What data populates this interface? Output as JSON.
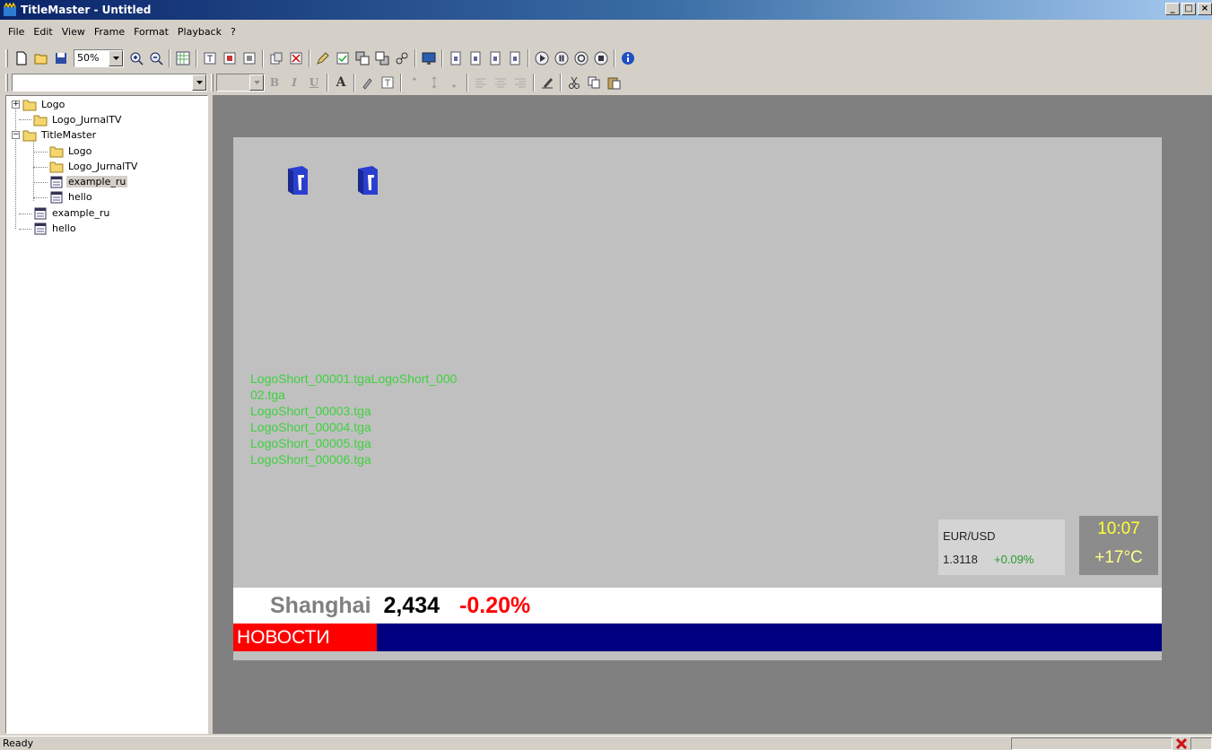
{
  "window": {
    "title": "TitleMaster - Untitled",
    "controls": [
      "_",
      "□",
      "×"
    ]
  },
  "menu": [
    "File",
    "Edit",
    "View",
    "Frame",
    "Format",
    "Playback",
    "?"
  ],
  "toolbar": {
    "zoom": "50%",
    "icons": [
      "new-icon",
      "open-icon",
      "save-icon",
      "zoom-in-icon",
      "zoom-out-icon",
      "grid-icon",
      "frame-icon",
      "play-icon",
      "pause-icon",
      "stop-icon",
      "info-icon"
    ]
  },
  "format_toolbar": {
    "font_value": "",
    "size_value": "",
    "bold": "B",
    "italic": "I",
    "underline": "U",
    "font": "A"
  },
  "tree": {
    "items": [
      {
        "label": "Logo",
        "type": "folder",
        "level": 0,
        "expander": "+"
      },
      {
        "label": "Logo_JurnalTV",
        "type": "folder",
        "level": 0
      },
      {
        "label": "TitleMaster",
        "type": "folder",
        "level": 0,
        "expander": "−"
      },
      {
        "label": "Logo",
        "type": "folder",
        "level": 1
      },
      {
        "label": "Logo_JurnalTV",
        "type": "folder",
        "level": 1
      },
      {
        "label": "example_ru",
        "type": "file",
        "level": 1,
        "selected": true
      },
      {
        "label": "hello",
        "type": "file",
        "level": 1
      },
      {
        "label": "example_ru",
        "type": "file",
        "level": 0
      },
      {
        "label": "hello",
        "type": "file",
        "level": 0
      }
    ]
  },
  "canvas": {
    "sequence_lines": [
      "LogoShort_00001.tgaLogoShort_000",
      "02.tga",
      "LogoShort_00003.tga",
      "LogoShort_00004.tga",
      "LogoShort_00005.tga",
      "LogoShort_00006.tga"
    ],
    "fx": {
      "pair": "EUR/USD",
      "rate": "1.3118",
      "change": "+0.09%"
    },
    "clock": {
      "time": "10:07",
      "temp": "+17°C"
    },
    "ticker": {
      "name": "Shanghai",
      "value": "2,434",
      "change": "-0.20%"
    },
    "news_label": "НОВОСТИ"
  },
  "status": {
    "text": "Ready"
  },
  "colors": {
    "sequence_text": "#3fd13f",
    "clock_text": "#ffff33",
    "fx_change": "#2a9a2a",
    "ticker_change": "#ff0000",
    "news_bg": "#ff0000",
    "bar_bg": "#000080"
  }
}
